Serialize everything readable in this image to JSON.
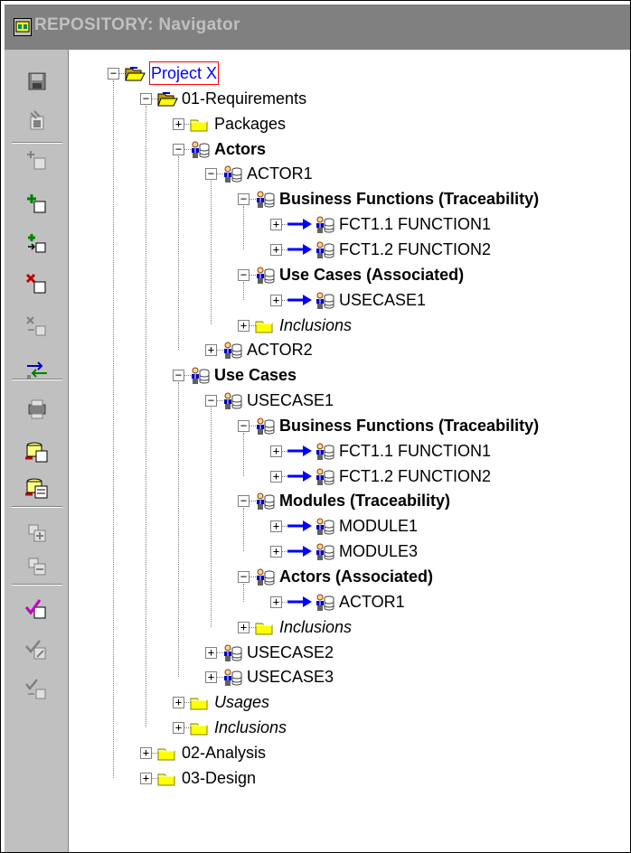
{
  "window": {
    "title": "REPOSITORY: Navigator",
    "icon": "navigator-app-icon"
  },
  "toolbar": {
    "buttons": [
      {
        "name": "save-button",
        "icon": "disk-icon"
      },
      {
        "name": "edit-object-button",
        "icon": "edit-icon"
      },
      {
        "name": "insert-object-button",
        "icon": "insert-icon"
      },
      {
        "name": "add-child-button",
        "icon": "add-child-icon"
      },
      {
        "name": "add-link-button",
        "icon": "add-link-icon"
      },
      {
        "name": "delete-button",
        "icon": "delete-icon"
      },
      {
        "name": "delete-link-button",
        "icon": "delete-link-icon"
      },
      {
        "name": "transfer-button",
        "icon": "transfer-icon"
      },
      {
        "name": "print-button",
        "icon": "print-icon"
      },
      {
        "name": "export-button",
        "icon": "export-icon"
      },
      {
        "name": "export-form-button",
        "icon": "export-form-icon"
      },
      {
        "name": "expand-button",
        "icon": "expand-icon"
      },
      {
        "name": "collapse-button",
        "icon": "collapse-icon"
      },
      {
        "name": "check-button",
        "icon": "check-icon"
      },
      {
        "name": "check-edit-button",
        "icon": "check-edit-icon"
      },
      {
        "name": "check-link-button",
        "icon": "check-link-icon"
      }
    ]
  },
  "tree": {
    "nodes": [
      {
        "label": "Project X",
        "icon": "folder-open",
        "state": "expanded",
        "selected": true
      },
      {
        "label": "01-Requirements",
        "icon": "folder-open",
        "state": "expanded"
      },
      {
        "label": "Packages",
        "icon": "folder",
        "state": "collapsed"
      },
      {
        "label": "Actors",
        "icon": "element",
        "state": "expanded",
        "style": "bold"
      },
      {
        "label": "ACTOR1",
        "icon": "element",
        "state": "expanded"
      },
      {
        "label": "Business Functions (Traceability)",
        "icon": "element",
        "state": "expanded",
        "style": "bold"
      },
      {
        "label": "FCT1.1 FUNCTION1",
        "icon": "element",
        "state": "collapsed",
        "link": true
      },
      {
        "label": "FCT1.2 FUNCTION2",
        "icon": "element",
        "state": "collapsed",
        "link": true
      },
      {
        "label": "Use Cases  (Associated)",
        "icon": "element",
        "state": "expanded",
        "style": "bold"
      },
      {
        "label": "USECASE1",
        "icon": "element",
        "state": "collapsed",
        "link": true
      },
      {
        "label": "Inclusions",
        "icon": "folder",
        "state": "collapsed",
        "style": "italic"
      },
      {
        "label": "ACTOR2",
        "icon": "element",
        "state": "collapsed"
      },
      {
        "label": "Use Cases",
        "icon": "element",
        "state": "expanded",
        "style": "bold"
      },
      {
        "label": "USECASE1",
        "icon": "element",
        "state": "expanded"
      },
      {
        "label": "Business Functions (Traceability)",
        "icon": "element",
        "state": "expanded",
        "style": "bold"
      },
      {
        "label": "FCT1.1 FUNCTION1",
        "icon": "element",
        "state": "collapsed",
        "link": true
      },
      {
        "label": "FCT1.2 FUNCTION2",
        "icon": "element",
        "state": "collapsed",
        "link": true
      },
      {
        "label": "Modules (Traceability)",
        "icon": "element",
        "state": "expanded",
        "style": "bold"
      },
      {
        "label": "MODULE1",
        "icon": "element",
        "state": "collapsed",
        "link": true
      },
      {
        "label": "MODULE3",
        "icon": "element",
        "state": "collapsed",
        "link": true
      },
      {
        "label": "Actors (Associated)",
        "icon": "element",
        "state": "expanded",
        "style": "bold"
      },
      {
        "label": "ACTOR1",
        "icon": "element",
        "state": "collapsed",
        "link": true
      },
      {
        "label": "Inclusions",
        "icon": "folder",
        "state": "collapsed",
        "style": "italic"
      },
      {
        "label": "USECASE2",
        "icon": "element",
        "state": "collapsed"
      },
      {
        "label": "USECASE3",
        "icon": "element",
        "state": "collapsed"
      },
      {
        "label": "Usages",
        "icon": "folder",
        "state": "collapsed",
        "style": "italic"
      },
      {
        "label": "Inclusions",
        "icon": "folder",
        "state": "collapsed",
        "style": "italic"
      },
      {
        "label": "02-Analysis",
        "icon": "folder",
        "state": "collapsed"
      },
      {
        "label": "03-Design",
        "icon": "folder",
        "state": "collapsed"
      }
    ]
  },
  "colors": {
    "titlebar": "#808080",
    "title_text": "#c0c0c0",
    "toolbar": "#c0c0c0",
    "selection_border": "#ff0000",
    "selection_text": "#0000ff",
    "link_arrow": "#0000ff"
  }
}
